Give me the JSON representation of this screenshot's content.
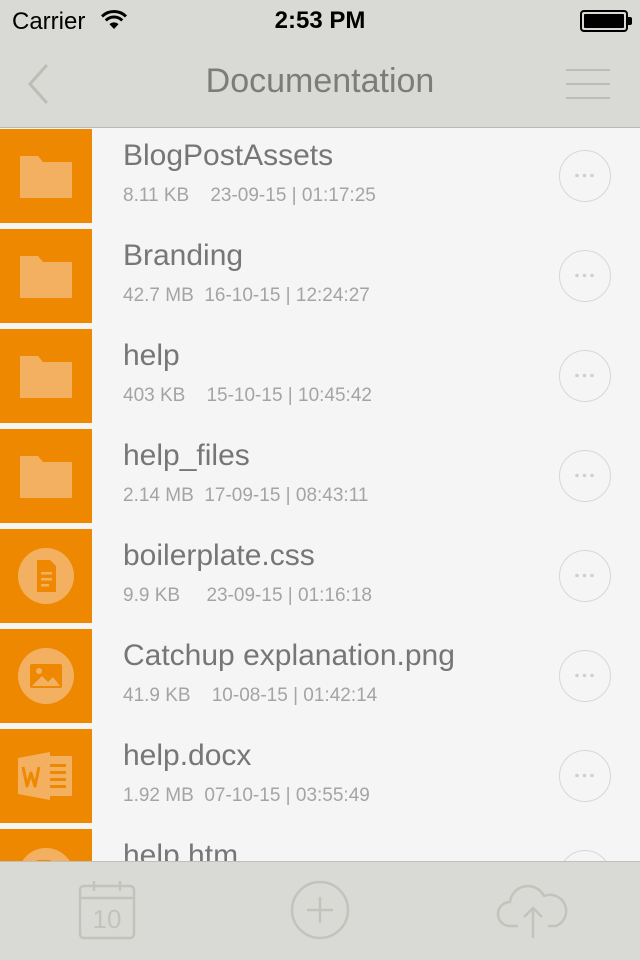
{
  "status_bar": {
    "carrier": "Carrier",
    "time": "2:53 PM",
    "icons": [
      "wifi-icon",
      "battery-icon"
    ]
  },
  "nav": {
    "title": "Documentation",
    "back_icon": "chevron-left-icon",
    "menu_icon": "hamburger-menu-icon"
  },
  "colors": {
    "accent": "#ee8800",
    "bar_background": "#d9d9d5",
    "list_background": "#f5f5f5",
    "title_text": "#767676",
    "meta_text": "#a4a4a4"
  },
  "files": [
    {
      "name": "BlogPostAssets",
      "size": "8.11 KB",
      "date": "23-09-15 | 01:17:25",
      "icon": "folder-icon"
    },
    {
      "name": "Branding",
      "size": "42.7 MB",
      "date": "16-10-15 | 12:24:27",
      "icon": "folder-icon"
    },
    {
      "name": "help",
      "size": "403 KB",
      "date": "15-10-15 | 10:45:42",
      "icon": "folder-icon"
    },
    {
      "name": "help_files",
      "size": "2.14 MB",
      "date": "17-09-15 | 08:43:11",
      "icon": "folder-icon"
    },
    {
      "name": "boilerplate.css",
      "size": "9.9 KB",
      "date": "23-09-15 | 01:16:18",
      "icon": "document-icon"
    },
    {
      "name": "Catchup explanation.png",
      "size": "41.9 KB",
      "date": "10-08-15 | 01:42:14",
      "icon": "image-icon"
    },
    {
      "name": "help.docx",
      "size": "1.92 MB",
      "date": "07-10-15 | 03:55:49",
      "icon": "word-document-icon"
    },
    {
      "name": "help.htm",
      "size": "",
      "date": "",
      "icon": "document-icon"
    }
  ],
  "row_action_icon": "more-options-icon",
  "tab_bar": {
    "calendar": {
      "icon": "calendar-icon",
      "day": "10"
    },
    "add": {
      "icon": "plus-circle-icon"
    },
    "upload": {
      "icon": "cloud-upload-icon"
    }
  }
}
